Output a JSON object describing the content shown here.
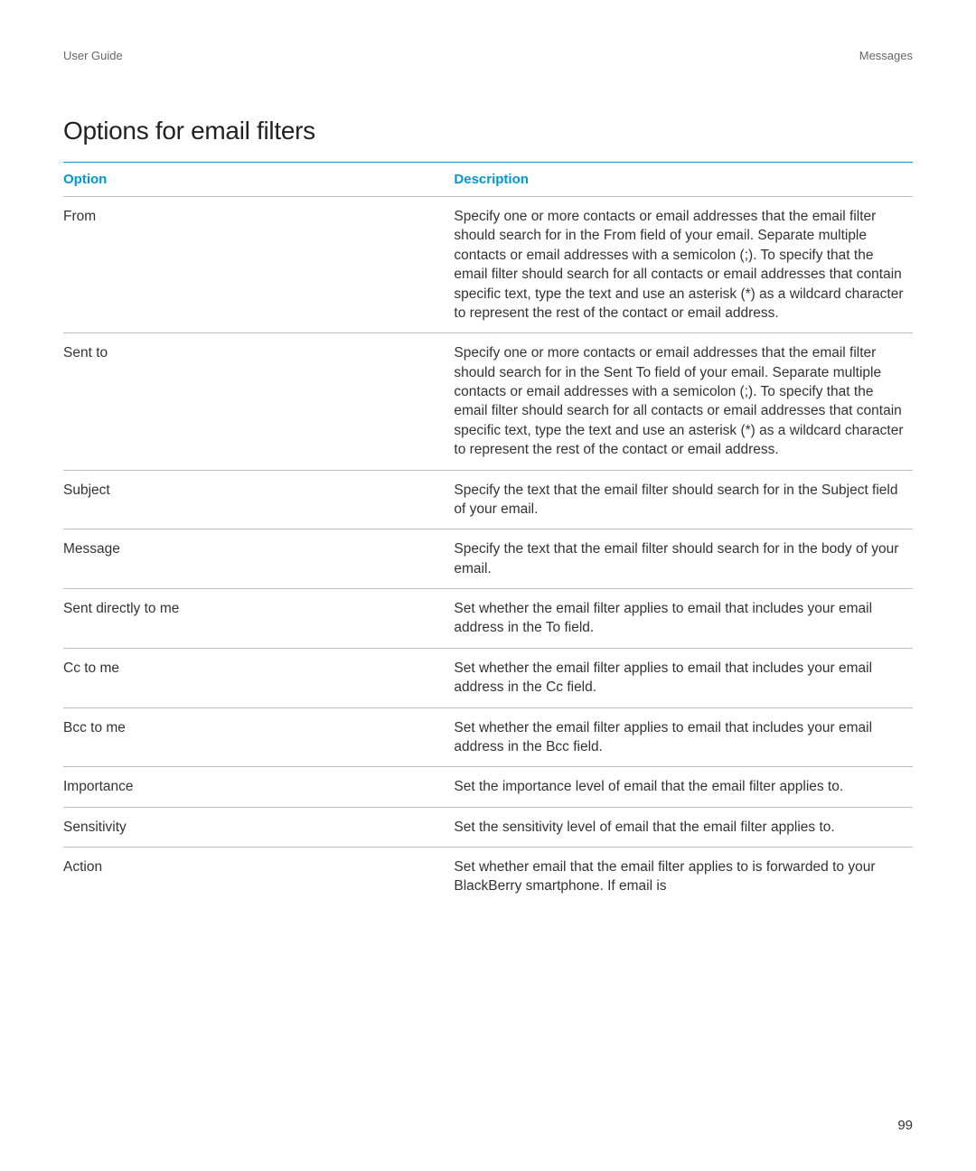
{
  "header": {
    "left": "User Guide",
    "right": "Messages"
  },
  "title": "Options for email filters",
  "table": {
    "headers": {
      "option": "Option",
      "description": "Description"
    },
    "rows": [
      {
        "option": "From",
        "description": "Specify one or more contacts or email addresses that the email filter should search for in the From field of your email. Separate multiple contacts or email addresses with a semicolon (;). To specify that the email filter should search for all contacts or email addresses that contain specific text, type the text and use an asterisk (*) as a wildcard character to represent the rest of the contact or email address."
      },
      {
        "option": "Sent to",
        "description": "Specify one or more contacts or email addresses that the email filter should search for in the Sent To field of your email. Separate multiple contacts or email addresses with a semicolon (;). To specify that the email filter should search for all contacts or email addresses that contain specific text, type the text and use an asterisk (*) as a wildcard character to represent the rest of the contact or email address."
      },
      {
        "option": "Subject",
        "description": "Specify the text that the email filter should search for in the Subject field of your email."
      },
      {
        "option": "Message",
        "description": "Specify the text that the email filter should search for in the body of your email."
      },
      {
        "option": "Sent directly to me",
        "description": "Set whether the email filter applies to email that includes your email address in the To field."
      },
      {
        "option": "Cc to me",
        "description": "Set whether the email filter applies to email that includes your email address in the Cc field."
      },
      {
        "option": "Bcc to me",
        "description": "Set whether the email filter applies to email that includes your email address in the Bcc field."
      },
      {
        "option": "Importance",
        "description": "Set the importance level of email that the email filter applies to."
      },
      {
        "option": "Sensitivity",
        "description": "Set the sensitivity level of email that the email filter applies to."
      },
      {
        "option": "Action",
        "description": "Set whether email that the email filter applies to is forwarded to your BlackBerry smartphone. If email is"
      }
    ]
  },
  "page_number": "99"
}
